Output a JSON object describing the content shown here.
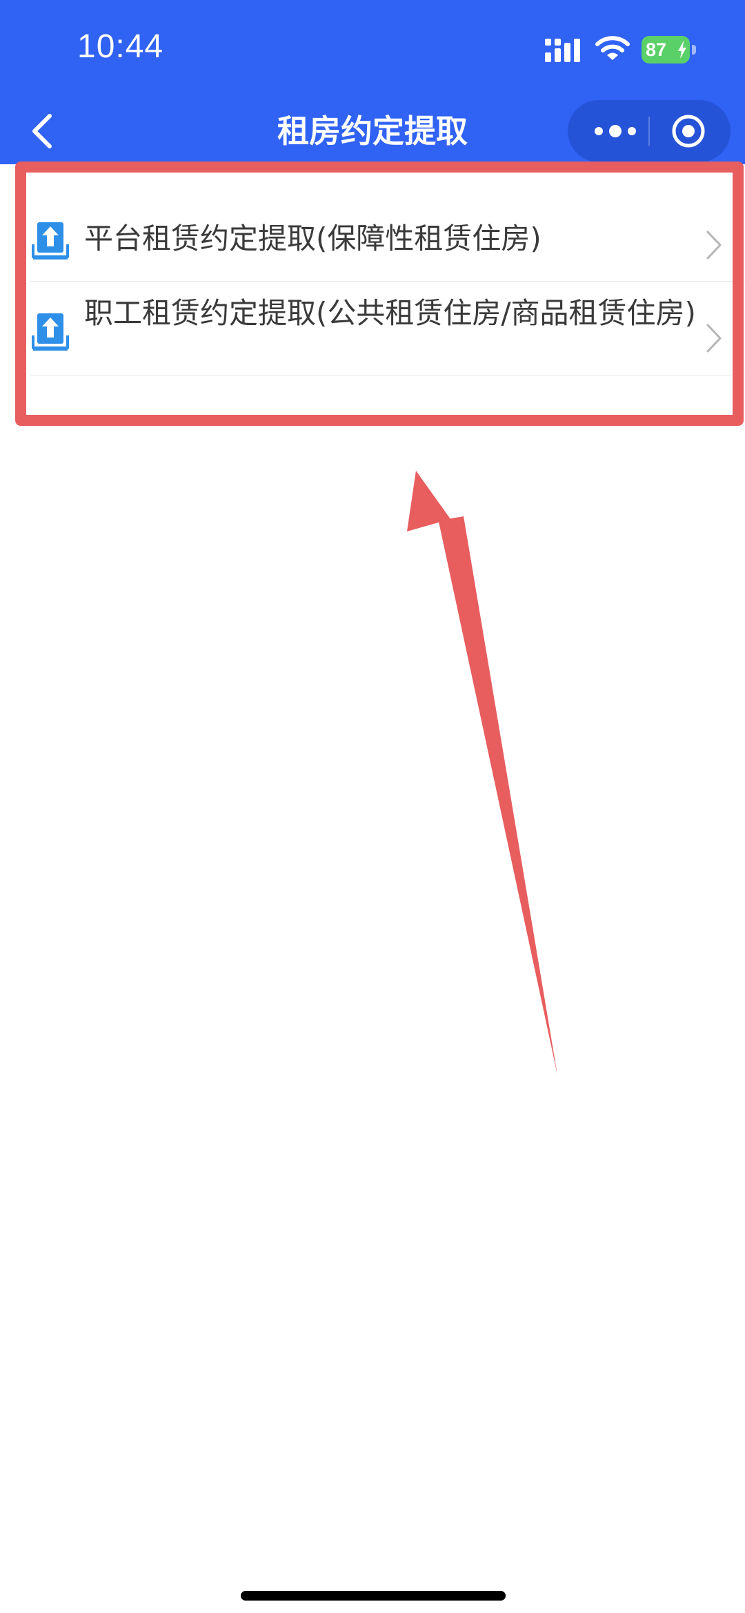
{
  "status_bar": {
    "time": "10:44",
    "battery": "87"
  },
  "nav": {
    "title": "租房约定提取",
    "back_icon": "chevron-left-icon",
    "capsule_icons": [
      "more-dots-icon",
      "target-circle-icon"
    ]
  },
  "list": {
    "items": [
      {
        "label": "平台租赁约定提取(保障性租赁住房)",
        "icon": "upload-tray-icon"
      },
      {
        "label": "职工租赁约定提取(公共租赁住房/商品租赁住房)",
        "icon": "upload-tray-icon"
      }
    ]
  },
  "colors": {
    "header": "#3062f4",
    "capsule": "#2553d8",
    "battery": "#5ad068",
    "annotation": "#e85d5e",
    "icon_blue": "#2e8fe8",
    "label_text": "#3a3a3a"
  }
}
